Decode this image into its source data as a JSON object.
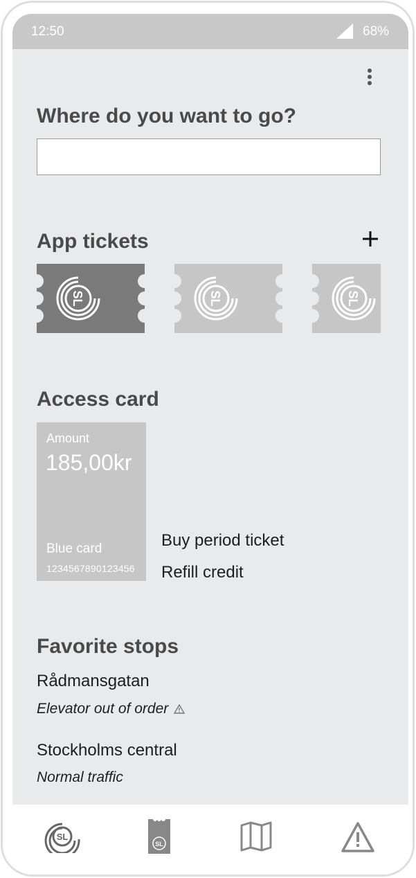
{
  "status_bar": {
    "time": "12:50",
    "battery": "68%",
    "signal_icon": "signal-icon"
  },
  "menu_icon": "more-vertical-icon",
  "search": {
    "title": "Where do you want to go?",
    "value": "",
    "placeholder": ""
  },
  "app_tickets": {
    "title": "App tickets",
    "add_icon": "plus-icon",
    "tickets": [
      {
        "logo": "SL",
        "state": "active",
        "color": "#7a7a7a"
      },
      {
        "logo": "SL",
        "state": "inactive",
        "color": "#c6c6c6"
      },
      {
        "logo": "SL",
        "state": "inactive",
        "color": "#c6c6c6"
      }
    ]
  },
  "access_card": {
    "title": "Access card",
    "amount_label": "Amount",
    "amount": "185,00kr",
    "card_name": "Blue card",
    "card_number": "1234567890123456",
    "actions": {
      "buy": "Buy period ticket",
      "refill": "Refill credit"
    }
  },
  "favorite_stops": {
    "title": "Favorite stops",
    "stops": [
      {
        "name": "Rådmansgatan",
        "status": "Elevator out of order",
        "status_icon": "warning-icon"
      },
      {
        "name": "Stockholms central",
        "status": "Normal traffic"
      }
    ]
  },
  "bottom_nav": {
    "items": [
      {
        "icon": "sl-logo-icon"
      },
      {
        "icon": "ticket-icon"
      },
      {
        "icon": "map-icon"
      },
      {
        "icon": "warning-icon"
      }
    ]
  },
  "colors": {
    "background": "#e9eaec",
    "status_bar": "#c8c8c8",
    "active_ticket": "#7a7a7a",
    "inactive": "#c6c6c6"
  }
}
